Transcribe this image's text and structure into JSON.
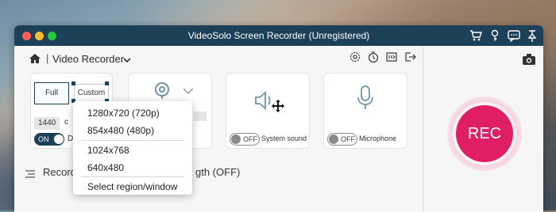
{
  "window": {
    "title": "VideoSolo Screen Recorder (Unregistered)"
  },
  "topbar": {
    "separator": "|",
    "mode_label": "Video Recorder"
  },
  "display_card": {
    "full_label": "Full",
    "custom_label": "Custom",
    "width_value": "1440",
    "height_partial": "c",
    "toggle_state": "ON",
    "label_partial": "Dis"
  },
  "sound_card": {
    "toggle_state": "OFF",
    "label": "System sound"
  },
  "mic_card": {
    "toggle_state": "OFF",
    "label": "Microphone"
  },
  "rec_button": {
    "label": "REC"
  },
  "bottom_bar": {
    "left_text": "Recordin",
    "right_text": "gth (OFF)"
  },
  "dropdown": {
    "items": [
      "1280x720 (720p)",
      "854x480 (480p)",
      "1024x768",
      "640x480",
      "Select region/window"
    ]
  },
  "colors": {
    "titlebar": "#1b4057",
    "rec": "#e01e66"
  }
}
